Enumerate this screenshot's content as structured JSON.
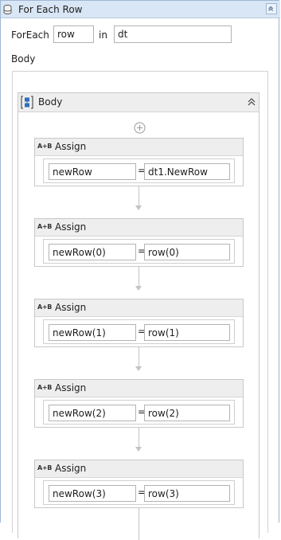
{
  "activity": {
    "title": "For Each Row",
    "icons": {
      "activity": "database-icon",
      "collapse": "chevron-double-up-icon"
    }
  },
  "foreach": {
    "label": "ForEach",
    "item_value": "row",
    "in_label": "in",
    "collection_value": "dt"
  },
  "body_label": "Body",
  "sequence": {
    "title": "Body",
    "icons": {
      "sequence": "sequence-icon",
      "collapse": "chevron-double-up-icon",
      "add": "plus-circle-icon"
    }
  },
  "assigns": [
    {
      "title": "Assign",
      "to": "newRow",
      "value": "dt1.NewRow"
    },
    {
      "title": "Assign",
      "to": "newRow(0)",
      "value": "row(0)"
    },
    {
      "title": "Assign",
      "to": "newRow(1)",
      "value": "row(1)"
    },
    {
      "title": "Assign",
      "to": "newRow(2)",
      "value": "row(2)"
    },
    {
      "title": "Assign",
      "to": "newRow(3)",
      "value": "row(3)"
    }
  ],
  "assign_icon_text": "A+B",
  "equals": "=",
  "colors": {
    "header": "#d9e6f5",
    "border": "#9fb6d4",
    "card_head": "#eeeeee",
    "sequence_icon": "#2f6fbf"
  }
}
